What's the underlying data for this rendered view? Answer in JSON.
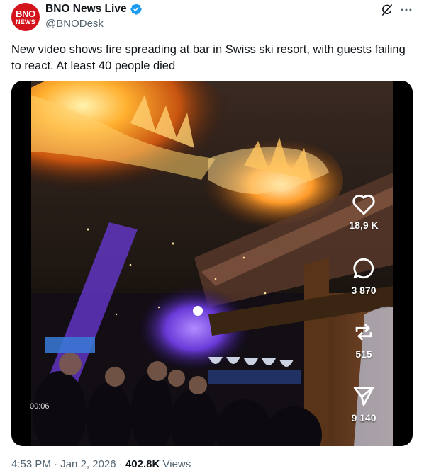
{
  "author": {
    "avatar_line1": "BNO",
    "avatar_line2": "NEWS",
    "display_name": "BNO News Live",
    "handle": "@BNODesk",
    "verified_color": "#1d9bf0"
  },
  "post": {
    "text": "New video shows fire spreading at bar in Swiss ski resort, with guests failing to react. At least 40 people died"
  },
  "video": {
    "elapsed": "00:06",
    "likes": "18,9 K",
    "comments": "3 870",
    "reposts": "515",
    "shares": "9 140"
  },
  "footer": {
    "time": "4:53 PM",
    "separator": "·",
    "date": "Jan 2, 2026",
    "views_count": "402.8K",
    "views_label": "Views"
  },
  "icons": [
    "verified-badge-icon",
    "grok-icon",
    "more-icon",
    "heart-icon",
    "comment-icon",
    "repost-icon",
    "share-icon"
  ]
}
